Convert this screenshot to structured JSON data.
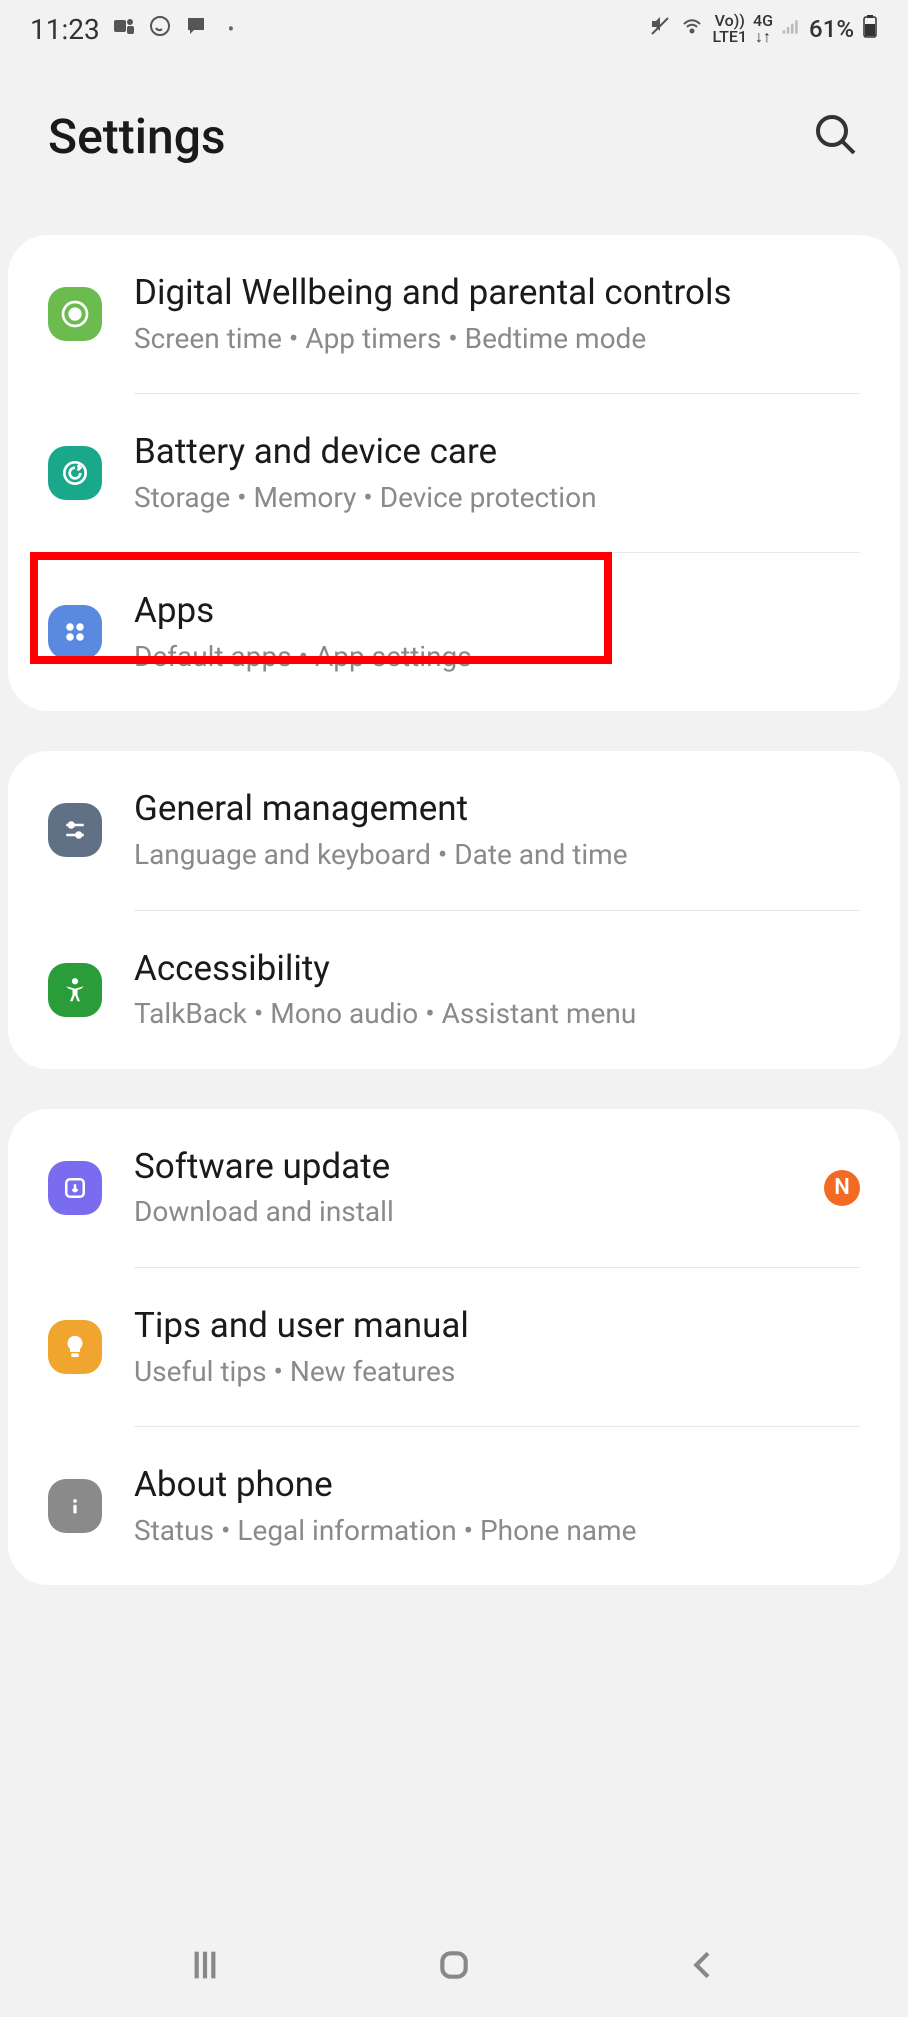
{
  "status_bar": {
    "time": "11:23",
    "battery_pct": "61%",
    "network_label_top": "Vo))",
    "network_label_bottom": "LTE1",
    "network_4g": "4G"
  },
  "header": {
    "title": "Settings"
  },
  "groups": [
    {
      "items": [
        {
          "title": "Digital Wellbeing and parental controls",
          "subtitle": "Screen time  •  App timers  •  Bedtime mode",
          "icon": "wellbeing",
          "icon_bg": "#6bbb4f"
        },
        {
          "title": "Battery and device care",
          "subtitle": "Storage  •  Memory  •  Device protection",
          "icon": "battery-care",
          "icon_bg": "#1aa88b"
        },
        {
          "title": "Apps",
          "subtitle": "Default apps  •  App settings",
          "icon": "apps",
          "icon_bg": "#5a8ae0",
          "highlighted": true
        }
      ]
    },
    {
      "items": [
        {
          "title": "General management",
          "subtitle": "Language and keyboard  •  Date and time",
          "icon": "sliders",
          "icon_bg": "#607185"
        },
        {
          "title": "Accessibility",
          "subtitle": "TalkBack  •  Mono audio  •  Assistant menu",
          "icon": "accessibility",
          "icon_bg": "#2a9c3a"
        }
      ]
    },
    {
      "items": [
        {
          "title": "Software update",
          "subtitle": "Download and install",
          "icon": "update",
          "icon_bg": "#7a6cef",
          "badge": "N"
        },
        {
          "title": "Tips and user manual",
          "subtitle": "Useful tips  •  New features",
          "icon": "tip",
          "icon_bg": "#f0a52e"
        },
        {
          "title": "About phone",
          "subtitle": "Status  •  Legal information  •  Phone name",
          "icon": "info",
          "icon_bg": "#8a8a8a"
        }
      ]
    }
  ]
}
